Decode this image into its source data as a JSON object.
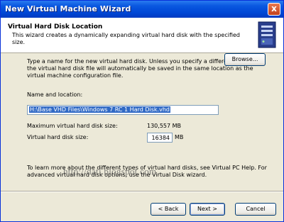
{
  "window": {
    "title": "New Virtual Machine Wizard",
    "close_label": "x"
  },
  "header": {
    "title": "Virtual Hard Disk Location",
    "description": "This wizard creates a dynamically expanding virtual hard disk with the specified size.",
    "icon": "server-icon"
  },
  "content": {
    "intro": "Type a name for the new virtual hard disk. Unless you specify a different location, the virtual hard disk file will automatically be saved in the same location as the virtual machine configuration file.",
    "name_label": "Name and location:",
    "path_value": "H:\\Base VHD Files\\Windows 7 RC 1 Hard Disk.vhd",
    "browse_label": "Browse...",
    "max_label": "Maximum virtual hard disk size:",
    "max_value": "130,557 MB",
    "size_label": "Virtual hard disk size:",
    "size_value": "16384",
    "size_unit": "MB",
    "footer_text": "To learn more about the different types of virtual hard disks, see Virtual PC Help. For advanced virtual hard disk options, use the Virtual Disk wizard.",
    "watermark": "http://dati.blogspot.com"
  },
  "buttons": {
    "back": "< Back",
    "next": "Next >",
    "cancel": "Cancel"
  },
  "colors": {
    "titlebar": "#0047d6",
    "dialog_bg": "#ece9d8",
    "selection": "#316ac5"
  }
}
